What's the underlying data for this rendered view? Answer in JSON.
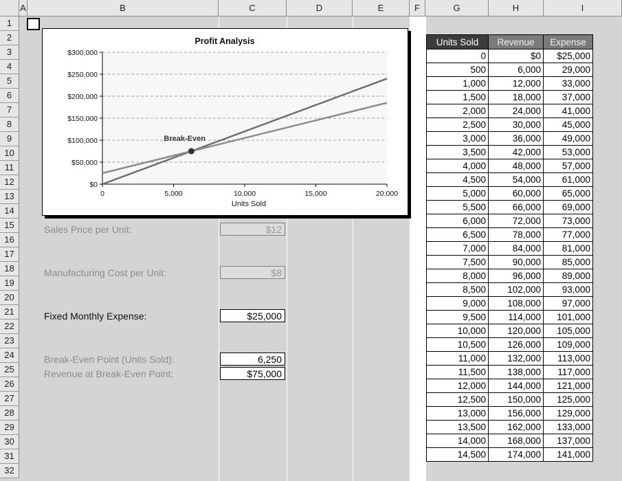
{
  "columns": [
    "A",
    "B",
    "C",
    "D",
    "E",
    "F",
    "G",
    "H",
    "I"
  ],
  "rows": [
    1,
    2,
    3,
    4,
    5,
    6,
    7,
    8,
    9,
    10,
    11,
    12,
    13,
    14,
    15,
    16,
    17,
    18,
    19,
    20,
    21,
    22,
    23,
    24,
    25,
    26,
    27,
    28,
    29,
    30,
    31,
    32
  ],
  "chart": {
    "title": "Profit Analysis",
    "xlabel": "Units Sold",
    "x_ticks": [
      "0",
      "5,000",
      "10,000",
      "15,000",
      "20,000"
    ],
    "y_ticks": [
      "$300,000",
      "$250,000",
      "$200,000",
      "$150,000",
      "$100,000",
      "$50,000",
      "$0"
    ],
    "annotation": "Break-Even"
  },
  "chart_data": {
    "type": "line",
    "title": "Profit Analysis",
    "xlabel": "Units Sold",
    "ylabel": "",
    "xlim": [
      0,
      20000
    ],
    "ylim": [
      0,
      300000
    ],
    "grid": true,
    "series": [
      {
        "values": [
          [
            0,
            0
          ],
          [
            20000,
            240000
          ]
        ]
      },
      {
        "values": [
          [
            0,
            25000
          ],
          [
            20000,
            185000
          ]
        ]
      }
    ],
    "annotations": [
      {
        "text": "Break-Even",
        "x": 6250,
        "y": 75000
      }
    ]
  },
  "inputs": {
    "sales_price_label": "Sales Price per Unit:",
    "sales_price_value": "$12",
    "mfg_cost_label": "Manufacturing Cost per Unit:",
    "mfg_cost_value": "$8",
    "fixed_expense_label": "Fixed Monthly Expense:",
    "fixed_expense_value": "$25,000",
    "break_even_units_label": "Break-Even Point (Units Sold):",
    "break_even_units_value": "6,250",
    "break_even_revenue_label": "Revenue at Break-Even Point:",
    "break_even_revenue_value": "$75,000"
  },
  "table": {
    "headers": [
      "Units Sold",
      "Revenue",
      "Expense"
    ],
    "rows": [
      [
        "0",
        "$0",
        "$25,000"
      ],
      [
        "500",
        "6,000",
        "29,000"
      ],
      [
        "1,000",
        "12,000",
        "33,000"
      ],
      [
        "1,500",
        "18,000",
        "37,000"
      ],
      [
        "2,000",
        "24,000",
        "41,000"
      ],
      [
        "2,500",
        "30,000",
        "45,000"
      ],
      [
        "3,000",
        "36,000",
        "49,000"
      ],
      [
        "3,500",
        "42,000",
        "53,000"
      ],
      [
        "4,000",
        "48,000",
        "57,000"
      ],
      [
        "4,500",
        "54,000",
        "61,000"
      ],
      [
        "5,000",
        "60,000",
        "65,000"
      ],
      [
        "5,500",
        "66,000",
        "69,000"
      ],
      [
        "6,000",
        "72,000",
        "73,000"
      ],
      [
        "6,500",
        "78,000",
        "77,000"
      ],
      [
        "7,000",
        "84,000",
        "81,000"
      ],
      [
        "7,500",
        "90,000",
        "85,000"
      ],
      [
        "8,000",
        "96,000",
        "89,000"
      ],
      [
        "8,500",
        "102,000",
        "93,000"
      ],
      [
        "9,000",
        "108,000",
        "97,000"
      ],
      [
        "9,500",
        "114,000",
        "101,000"
      ],
      [
        "10,000",
        "120,000",
        "105,000"
      ],
      [
        "10,500",
        "126,000",
        "109,000"
      ],
      [
        "11,000",
        "132,000",
        "113,000"
      ],
      [
        "11,500",
        "138,000",
        "117,000"
      ],
      [
        "12,000",
        "144,000",
        "121,000"
      ],
      [
        "12,500",
        "150,000",
        "125,000"
      ],
      [
        "13,000",
        "156,000",
        "129,000"
      ],
      [
        "13,500",
        "162,000",
        "133,000"
      ],
      [
        "14,000",
        "168,000",
        "137,000"
      ],
      [
        "14,500",
        "174,000",
        "141,000"
      ]
    ]
  }
}
